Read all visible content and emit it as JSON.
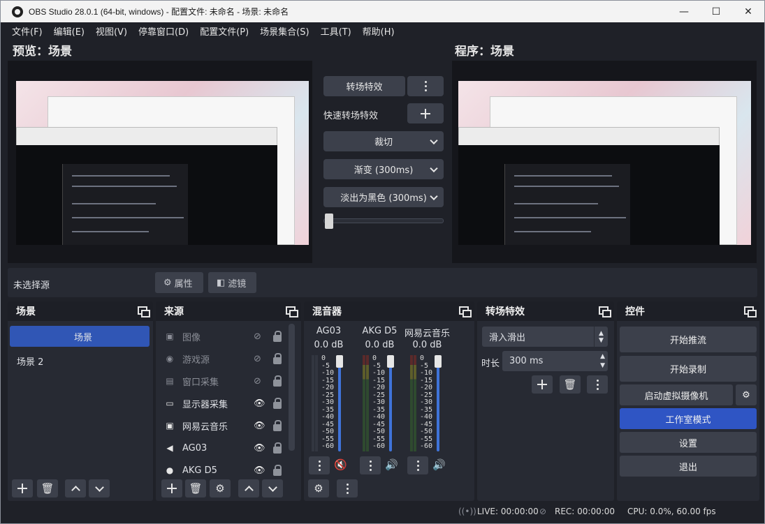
{
  "window": {
    "title": "OBS Studio 28.0.1 (64-bit, windows) - 配置文件: 未命名 - 场景: 未命名",
    "min": "—",
    "max": "☐",
    "close": "✕"
  },
  "menu": [
    "文件(F)",
    "编辑(E)",
    "视图(V)",
    "停靠窗口(D)",
    "配置文件(P)",
    "场景集合(S)",
    "工具(T)",
    "帮助(H)"
  ],
  "preview": {
    "left_label": "预览：场景",
    "right_label": "程序：场景"
  },
  "transition_panel": {
    "transition_button": "转场特效",
    "quick_label": "快速转场特效",
    "quick_items": [
      "裁切",
      "渐变 (300ms)",
      "淡出为黑色 (300ms)"
    ],
    "slider_position": 0
  },
  "source_bar": {
    "no_source": "未选择源",
    "properties": "属性",
    "filters": "滤镜"
  },
  "scenes": {
    "title": "场景",
    "items": [
      "场景",
      "场景 2"
    ],
    "selected_index": 0
  },
  "sources": {
    "title": "来源",
    "items": [
      {
        "label": "图像",
        "icon": "image-icon",
        "glyph": "▣",
        "visible": false
      },
      {
        "label": "游戏源",
        "icon": "gamepad-icon",
        "glyph": "◉",
        "visible": false
      },
      {
        "label": "窗口采集",
        "icon": "window-icon",
        "glyph": "▤",
        "visible": false
      },
      {
        "label": "显示器采集",
        "icon": "monitor-icon",
        "glyph": "▭",
        "visible": true
      },
      {
        "label": "网易云音乐",
        "icon": "audio-output-icon",
        "glyph": "▣",
        "visible": true
      },
      {
        "label": "AG03",
        "icon": "speaker-icon",
        "glyph": "◀",
        "visible": true
      },
      {
        "label": "AKG D5",
        "icon": "microphone-icon",
        "glyph": "●",
        "visible": true
      }
    ]
  },
  "mixer": {
    "title": "混音器",
    "channels": [
      {
        "name": "AG03",
        "db": "0.0 dB",
        "muted": true
      },
      {
        "name": "AKG D5",
        "db": "0.0 dB",
        "muted": false
      },
      {
        "name": "网易云音乐",
        "db": "0.0 dB",
        "muted": false
      }
    ],
    "scale": [
      "0",
      "-5",
      "-10",
      "-15",
      "-20",
      "-25",
      "-30",
      "-35",
      "-40",
      "-45",
      "-50",
      "-55",
      "-60"
    ]
  },
  "transitions": {
    "title": "转场特效",
    "selected": "滑入滑出",
    "duration_label": "时长",
    "duration_value": "300 ms"
  },
  "controls": {
    "title": "控件",
    "start_stream": "开始推流",
    "start_record": "开始录制",
    "virtual_cam": "启动虚拟摄像机",
    "studio_mode": "工作室模式",
    "settings": "设置",
    "exit": "退出"
  },
  "status": {
    "live": "LIVE: 00:00:00",
    "rec": "REC: 00:00:00",
    "cpu": "CPU: 0.0%, 60.00 fps"
  },
  "colors": {
    "accent": "#2f55c4",
    "panel": "#272a33",
    "button": "#3c404b",
    "volume": "#3f73d9",
    "muted": "#d9363e"
  }
}
